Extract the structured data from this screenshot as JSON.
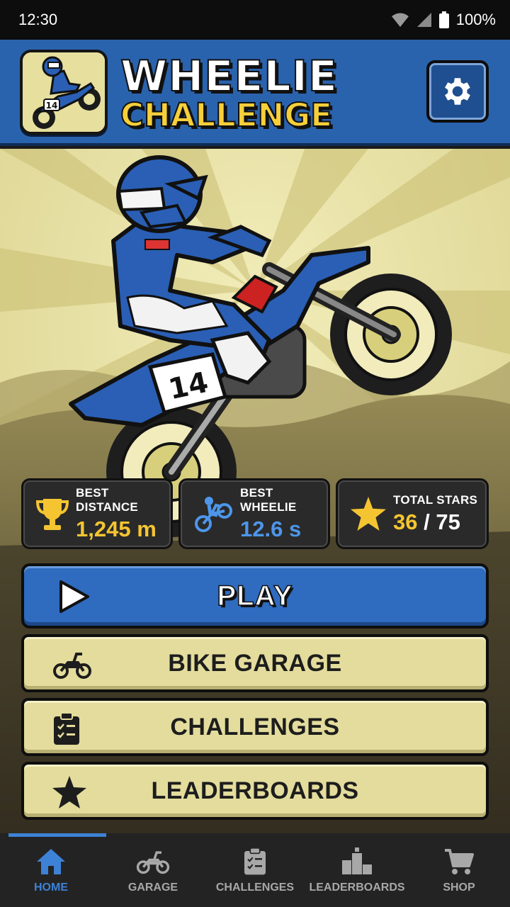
{
  "status_bar": {
    "time": "12:30",
    "battery": "100%"
  },
  "header": {
    "title_line1": "WHEELIE",
    "title_line2": "CHALLENGE"
  },
  "hero": {
    "bike_number": "14"
  },
  "stats": [
    {
      "label": "BEST DISTANCE",
      "value": "1,245 m",
      "icon": "trophy-icon"
    },
    {
      "label": "BEST WHEELIE",
      "value": "12.6 s",
      "icon": "wheelie-bike-icon"
    },
    {
      "label": "TOTAL STARS",
      "value_current": "36",
      "value_total": "/ 75",
      "icon": "star-icon"
    }
  ],
  "buttons": {
    "play": "PLAY",
    "garage": "BIKE GARAGE",
    "challenges": "CHALLENGES",
    "leaderboards": "LEADERBOARDS"
  },
  "nav": {
    "items": [
      {
        "label": "HOME",
        "icon": "home-icon",
        "active": true
      },
      {
        "label": "GARAGE",
        "icon": "motorcycle-icon",
        "active": false
      },
      {
        "label": "CHALLENGES",
        "icon": "clipboard-icon",
        "active": false
      },
      {
        "label": "LEADERBOARDS",
        "icon": "podium-icon",
        "active": false
      },
      {
        "label": "SHOP",
        "icon": "cart-icon",
        "active": false
      }
    ]
  },
  "colors": {
    "accent_blue": "#2f6bbf",
    "header_blue": "#2a63ad",
    "gold": "#f5c531",
    "cream": "#e3dc9c"
  }
}
